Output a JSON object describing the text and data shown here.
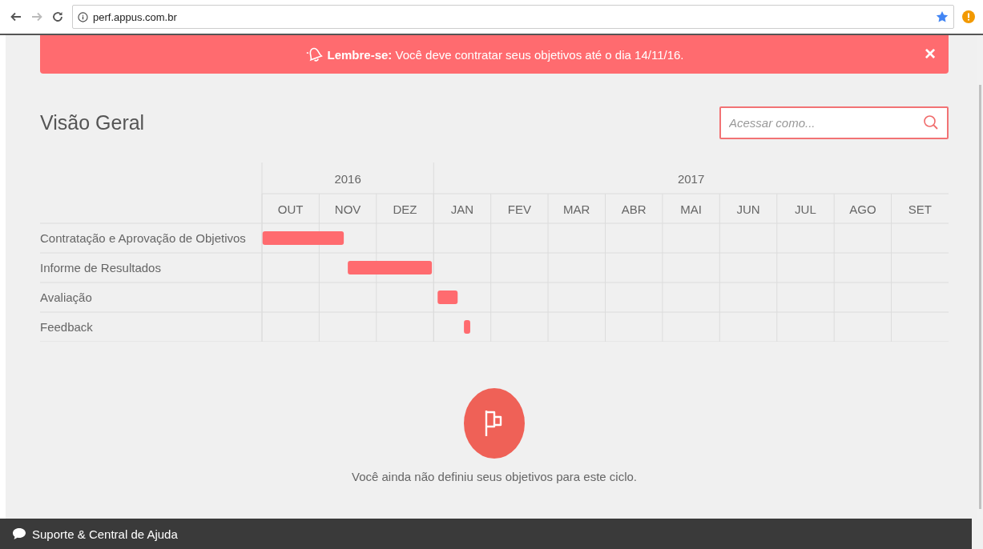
{
  "browser": {
    "url": "perf.appus.com.br"
  },
  "alert": {
    "text": "**Lembre-se:** Você deve contratar seus objetivos até o dia 14/11/16.",
    "close": "×"
  },
  "title": "Visão Geral",
  "search": {
    "placeholder": "Acessar como..."
  },
  "timeline": {
    "years": [
      {
        "label": "2016",
        "months": [
          "OUT",
          "NOV",
          "DEZ"
        ]
      },
      {
        "label": "2017",
        "months": [
          "JAN",
          "FEV",
          "MAR",
          "ABR",
          "MAI",
          "JUN",
          "JUL",
          "AGO",
          "SET"
        ]
      }
    ],
    "phases": [
      "Contratação e Aprovação de Objetivos",
      "Informe de Resultados",
      "Avaliação",
      "Feedback"
    ]
  },
  "empty_state": {
    "message": "Você ainda não definiu seus objetivos para este ciclo."
  },
  "footer": {
    "label": "Suporte & Central de Ajuda"
  }
}
